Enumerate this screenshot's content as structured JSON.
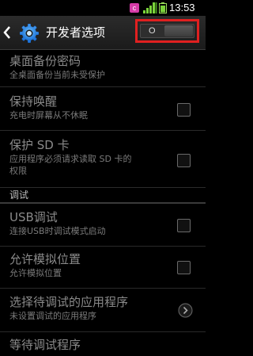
{
  "status_bar": {
    "time": "13:53",
    "notification_badge": "c",
    "icons": [
      "app-notification-icon",
      "signal-icon",
      "battery-icon"
    ]
  },
  "action_bar": {
    "title": "开发者选项",
    "master_switch_label": "O",
    "master_switch_state": "off",
    "highlight_color": "#e02020"
  },
  "preferences": [
    {
      "title": "桌面备份密码",
      "summary": "全桌面备份当前未受保护",
      "control": "none"
    },
    {
      "title": "保持唤醒",
      "summary": "充电时屏幕从不休眠",
      "control": "checkbox",
      "checked": false
    },
    {
      "title": "保护 SD 卡",
      "summary_line1": "应用程序必须请求读取 SD 卡的",
      "summary_line2": "权限",
      "control": "checkbox",
      "checked": false
    }
  ],
  "debug_section": {
    "header": "调试",
    "items": [
      {
        "title": "USB调试",
        "summary": "连接USB时调试模式启动",
        "control": "checkbox",
        "checked": false
      },
      {
        "title": "允许模拟位置",
        "summary": "允许模拟位置",
        "control": "checkbox",
        "checked": false
      },
      {
        "title": "选择待调试的应用程序",
        "summary": "未设置调试的应用程序",
        "control": "chevron-right-icon"
      },
      {
        "title": "等待调试程序",
        "summary": ""
      }
    ]
  }
}
